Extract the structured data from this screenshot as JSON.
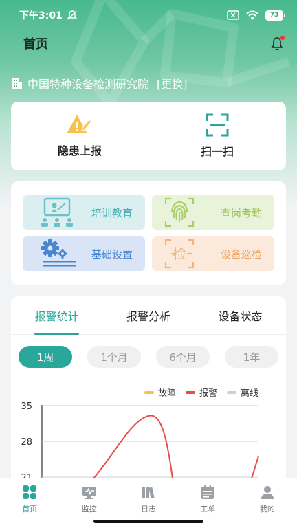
{
  "status_bar": {
    "time": "下午3:01",
    "battery": "73"
  },
  "header": {
    "title": "首页"
  },
  "org": {
    "name": "中国特种设备检测研究院",
    "change_label": "[更换]"
  },
  "quick_actions": [
    {
      "label": "隐患上报",
      "icon": "warning-report-icon"
    },
    {
      "label": "扫一扫",
      "icon": "scan-icon"
    }
  ],
  "modules": [
    {
      "label": "培训教育",
      "icon": "training-icon",
      "color": "#4bb0b8"
    },
    {
      "label": "查岗考勤",
      "icon": "fingerprint-icon",
      "color": "#9cc35a"
    },
    {
      "label": "基础设置",
      "icon": "settings-gears-icon",
      "color": "#4a86cf"
    },
    {
      "label": "设备巡检",
      "icon": "inspection-icon",
      "color": "#f0a25f"
    }
  ],
  "stats_tabs": [
    {
      "label": "报警统计",
      "active": true
    },
    {
      "label": "报警分析",
      "active": false
    },
    {
      "label": "设备状态",
      "active": false
    }
  ],
  "periods": [
    {
      "label": "1周",
      "active": true
    },
    {
      "label": "1个月",
      "active": false
    },
    {
      "label": "6个月",
      "active": false
    },
    {
      "label": "1年",
      "active": false
    }
  ],
  "chart_data": {
    "type": "line",
    "series": [
      {
        "name": "故障",
        "color": "#f5c24c"
      },
      {
        "name": "报警",
        "color": "#e84c4c"
      },
      {
        "name": "离线",
        "color": "#d0d0d0"
      }
    ],
    "y_ticks": [
      "35",
      "28",
      "21"
    ],
    "ylim": [
      21,
      35
    ],
    "grid": true
  },
  "tabbar": [
    {
      "label": "首页",
      "icon": "home-grid-icon",
      "active": true
    },
    {
      "label": "监控",
      "icon": "monitor-icon",
      "active": false
    },
    {
      "label": "日志",
      "icon": "log-books-icon",
      "active": false
    },
    {
      "label": "工单",
      "icon": "work-order-icon",
      "active": false
    },
    {
      "label": "我的",
      "icon": "profile-icon",
      "active": false
    }
  ]
}
